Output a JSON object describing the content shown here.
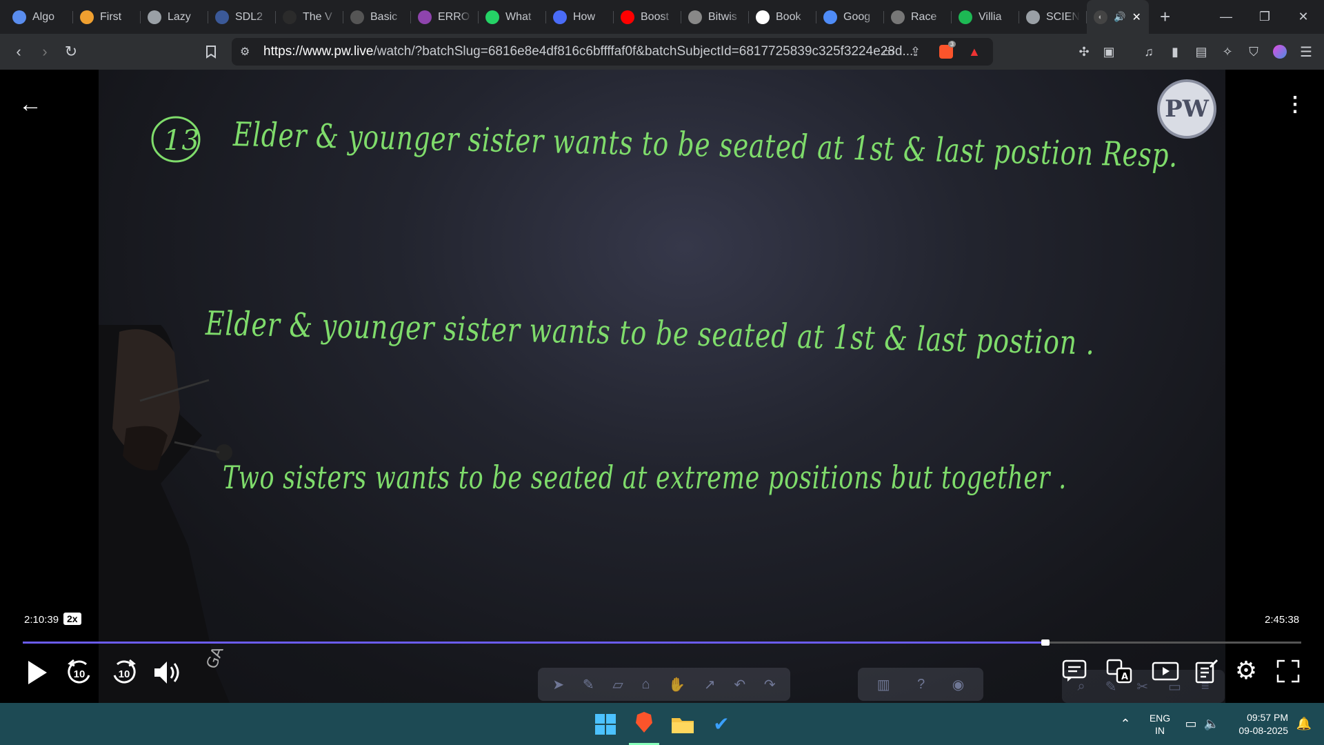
{
  "tabs": [
    {
      "label": "Algo",
      "icon": "algo-favicon",
      "color": "#5a8dee"
    },
    {
      "label": "First",
      "icon": "first-favicon",
      "color": "#f0a030"
    },
    {
      "label": "Lazy",
      "icon": "globe-favicon",
      "color": "#9aa0a6"
    },
    {
      "label": "SDL2",
      "icon": "sdl-favicon",
      "color": "#3b5998"
    },
    {
      "label": "The V",
      "icon": "w3schools-favicon",
      "color": "#2b2b2b"
    },
    {
      "label": "Basic",
      "icon": "basic-favicon",
      "color": "#555"
    },
    {
      "label": "ERRO",
      "icon": "error-favicon",
      "color": "#8e44ad"
    },
    {
      "label": "What",
      "icon": "whatsapp-favicon",
      "color": "#25d366"
    },
    {
      "label": "How",
      "icon": "how-favicon",
      "color": "#4a6cf7"
    },
    {
      "label": "Boost",
      "icon": "youtube-favicon",
      "color": "#ff0000"
    },
    {
      "label": "Bitwis",
      "icon": "bitwise-favicon",
      "color": "#888"
    },
    {
      "label": "Book",
      "icon": "google-favicon",
      "color": "#ffffff"
    },
    {
      "label": "Goog",
      "icon": "gemini-favicon",
      "color": "#4f8cf7"
    },
    {
      "label": "Race",
      "icon": "openai-favicon",
      "color": "#777"
    },
    {
      "label": "Villia",
      "icon": "spotify-favicon",
      "color": "#1db954"
    },
    {
      "label": "SCIEN",
      "icon": "globe-favicon",
      "color": "#9aa0a6"
    }
  ],
  "browser": {
    "url_host": "https://www.pw.live",
    "url_rest": "/watch/?batchSlug=6816e8e4df816c6bffffaf0f&batchSubjectId=6817725839c325f3224e28d...",
    "shield_count": "3"
  },
  "board": {
    "line1_number": "13",
    "line1": "Elder & younger sister wants to be seated at 1st & last postion Resp.",
    "line2": "Elder & younger sister wants to be seated at 1st & last postion .",
    "line3": "Two sisters wants to be seated at extreme positions but together .",
    "logo": "PW"
  },
  "player": {
    "current_time": "2:10:39",
    "speed": "2x",
    "duration": "2:45:38",
    "progress": 0.8,
    "rewind_label": "10",
    "forward_label": "10"
  },
  "taskbar": {
    "lang_top": "ENG",
    "lang_bottom": "IN",
    "time": "09:57 PM",
    "date": "09-08-2025"
  }
}
